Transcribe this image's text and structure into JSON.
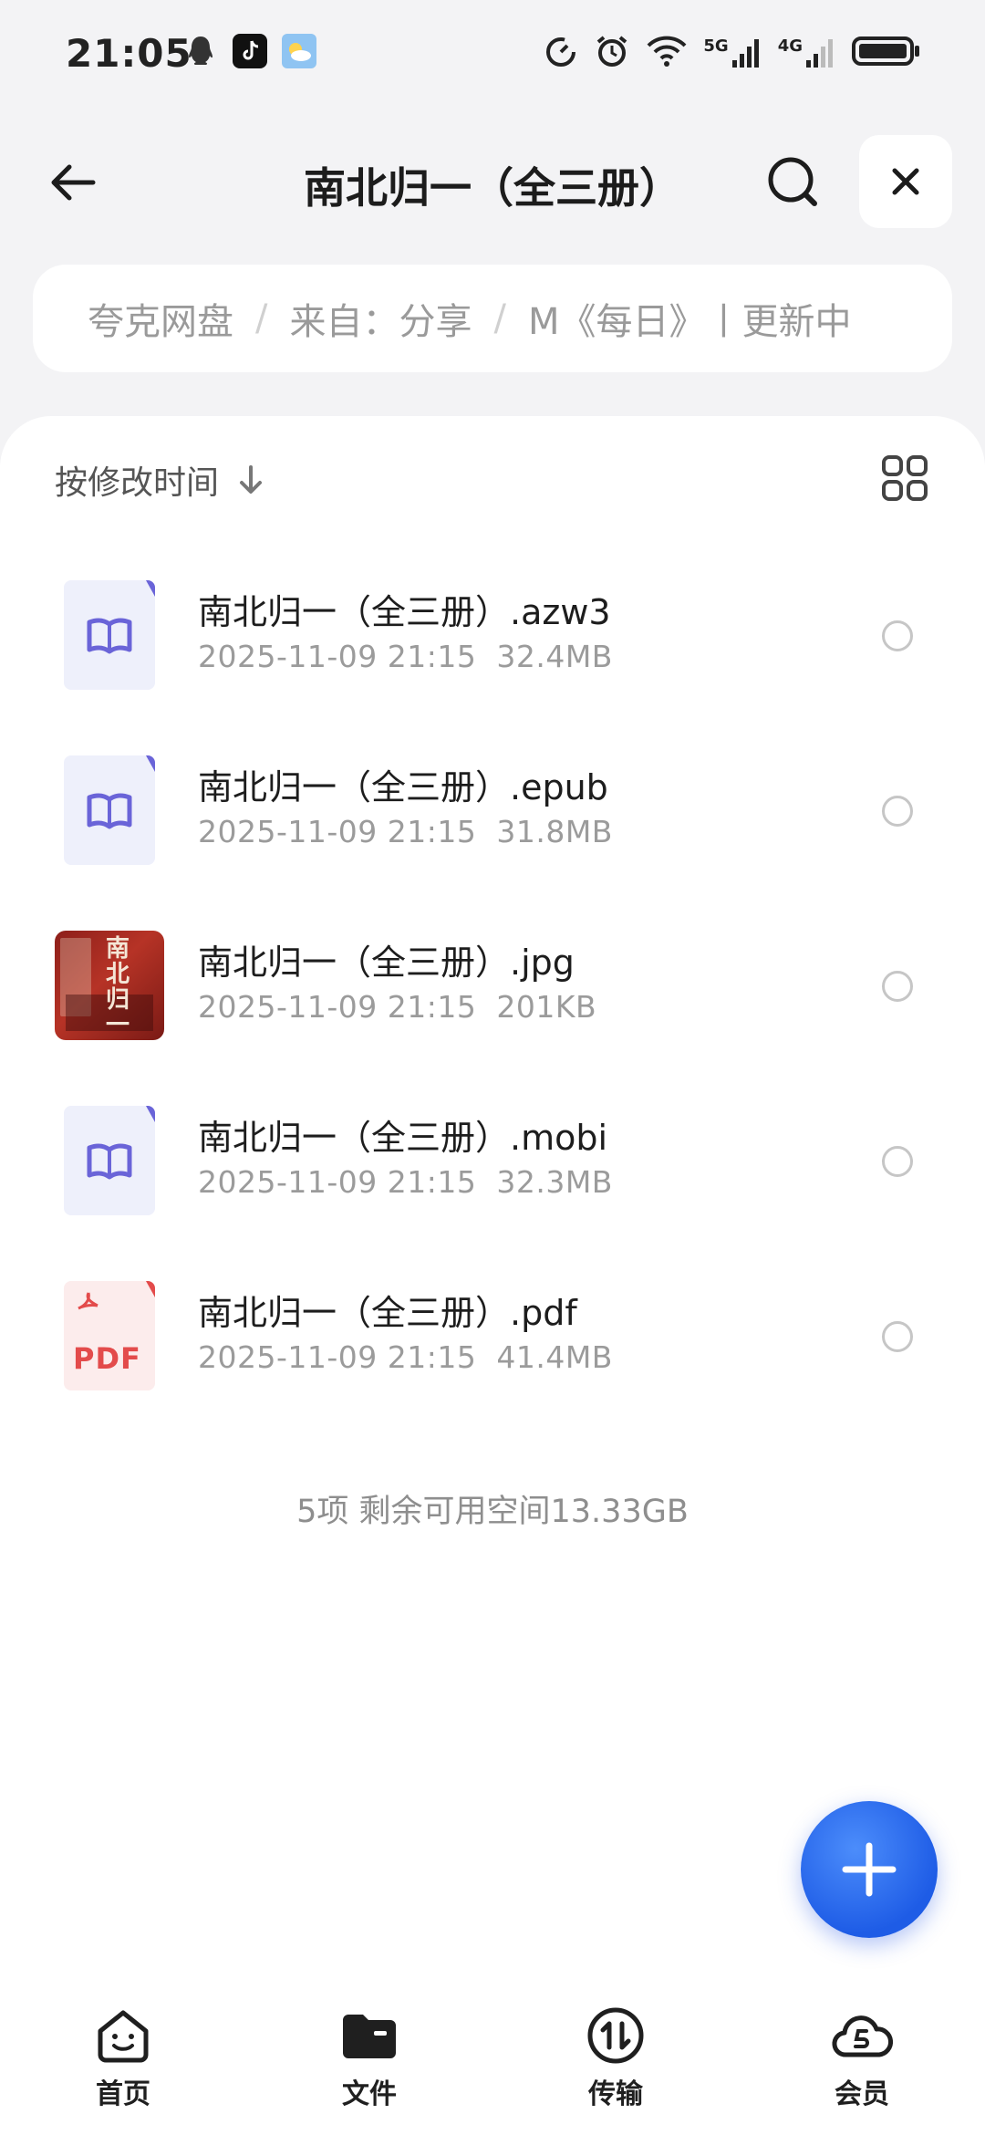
{
  "status_bar": {
    "time": "21:05",
    "net_5g": "5G",
    "net_4g": "4G"
  },
  "header": {
    "title": "南北归一（全三册）"
  },
  "breadcrumb": {
    "items": [
      "夸克网盘",
      "来自：分享",
      "M《每日》丨更新中"
    ]
  },
  "toolbar": {
    "sort_label": "按修改时间"
  },
  "files": [
    {
      "name": "南北归一（全三册）.azw3",
      "date": "2025-11-09 21:15",
      "size": "32.4MB",
      "icon": "ebook-icon"
    },
    {
      "name": "南北归一（全三册）.epub",
      "date": "2025-11-09 21:15",
      "size": "31.8MB",
      "icon": "ebook-icon"
    },
    {
      "name": "南北归一（全三册）.jpg",
      "date": "2025-11-09 21:15",
      "size": "201KB",
      "icon": "image-thumbnail"
    },
    {
      "name": "南北归一（全三册）.mobi",
      "date": "2025-11-09 21:15",
      "size": "32.3MB",
      "icon": "ebook-icon"
    },
    {
      "name": "南北归一（全三册）.pdf",
      "date": "2025-11-09 21:15",
      "size": "41.4MB",
      "icon": "pdf-icon"
    }
  ],
  "thumbnail_text": {
    "jpg_cover": "南北归一",
    "pdf_badge": "PDF"
  },
  "footer": {
    "summary": "5项 剩余可用空间13.33GB"
  },
  "bottom_nav": {
    "items": [
      {
        "label": "首页",
        "icon": "home-face-icon"
      },
      {
        "label": "文件",
        "icon": "folder-icon",
        "active": true
      },
      {
        "label": "传输",
        "icon": "transfer-icon"
      },
      {
        "label": "会员",
        "icon": "member-cloud-icon"
      }
    ]
  },
  "colors": {
    "accent": "#1e5ce6",
    "ebook_fold": "#6a64d8",
    "pdf_red": "#e34b4b"
  }
}
